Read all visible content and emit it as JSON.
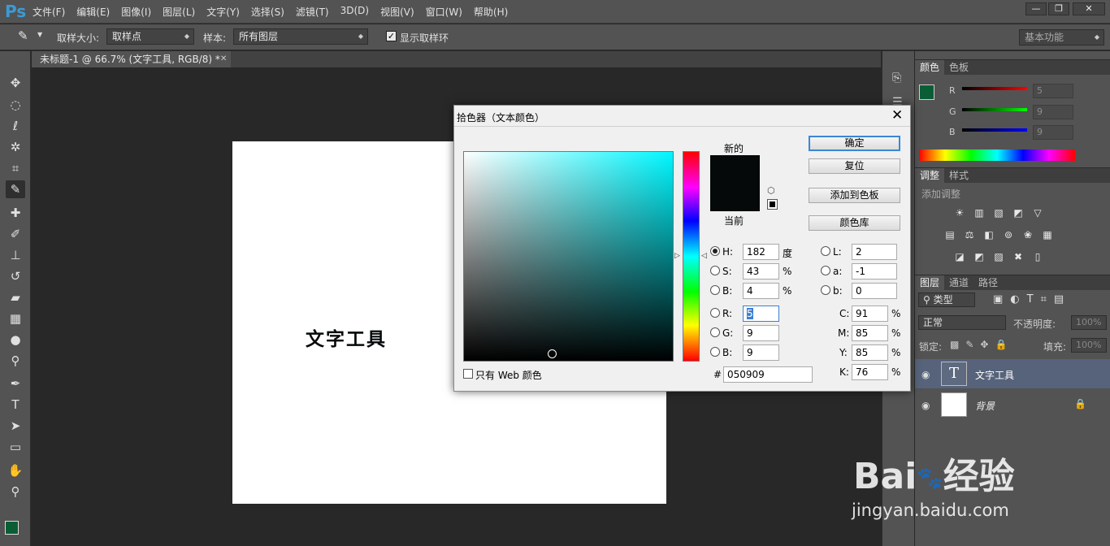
{
  "app": {
    "logo": "Ps",
    "menu": [
      "文件(F)",
      "编辑(E)",
      "图像(I)",
      "图层(L)",
      "文字(Y)",
      "选择(S)",
      "滤镜(T)",
      "3D(D)",
      "视图(V)",
      "窗口(W)",
      "帮助(H)"
    ],
    "window_buttons": [
      "—",
      "❐",
      "✕"
    ]
  },
  "options": {
    "sample_size_label": "取样大小:",
    "sample_size_value": "取样点",
    "sample_label": "样本:",
    "sample_value": "所有图层",
    "show_ring_label": "显示取样环",
    "show_ring_checked": true,
    "workspace": "基本功能"
  },
  "document": {
    "tab_title": "未标题-1 @ 66.7% (文字工具, RGB/8) *",
    "canvas_text": "文字工具"
  },
  "dialog": {
    "title": "拾色器（文本颜色）",
    "new_label": "新的",
    "current_label": "当前",
    "new_color": "#050909",
    "current_color": "#050909",
    "buttons": {
      "ok": "确定",
      "reset": "复位",
      "add_swatch": "添加到色板",
      "libraries": "颜色库"
    },
    "web_only_label": "只有 Web 颜色",
    "hsb": {
      "h_label": "H:",
      "h": "182",
      "h_unit": "度",
      "s_label": "S:",
      "s": "43",
      "s_unit": "%",
      "b_label": "B:",
      "b": "4",
      "b_unit": "%"
    },
    "rgb": {
      "r_label": "R:",
      "r": "5",
      "g_label": "G:",
      "g": "9",
      "b_label": "B:",
      "b": "9"
    },
    "lab": {
      "l_label": "L:",
      "l": "2",
      "a_label": "a:",
      "a": "-1",
      "b_label": "b:",
      "b": "0"
    },
    "cmyk": {
      "c_label": "C:",
      "c": "91",
      "m_label": "M:",
      "m": "85",
      "y_label": "Y:",
      "y": "85",
      "k_label": "K:",
      "k": "76",
      "unit": "%"
    },
    "hex_label": "#",
    "hex": "050909"
  },
  "color_panel": {
    "tabs": [
      "颜色",
      "色板"
    ],
    "fg_color": "#0b5d36",
    "bg_color": "#000000",
    "r_label": "R",
    "r": "5",
    "g_label": "G",
    "g": "9",
    "b_label": "B",
    "b": "9"
  },
  "adjustments_panel": {
    "tabs": [
      "调整",
      "样式"
    ],
    "title": "添加调整"
  },
  "layers_panel": {
    "tabs": [
      "图层",
      "通道",
      "路径"
    ],
    "kind_filter": "类型",
    "blend_mode": "正常",
    "opacity_label": "不透明度:",
    "opacity": "100%",
    "lock_label": "锁定:",
    "fill_label": "填充:",
    "fill": "100%",
    "layers": [
      {
        "name": "文字工具",
        "thumb": "T"
      },
      {
        "name": "背景",
        "thumb": ""
      }
    ]
  },
  "watermark": {
    "brand": "Bai",
    "brand2": "经验",
    "url": "jingyan.baidu.com"
  }
}
